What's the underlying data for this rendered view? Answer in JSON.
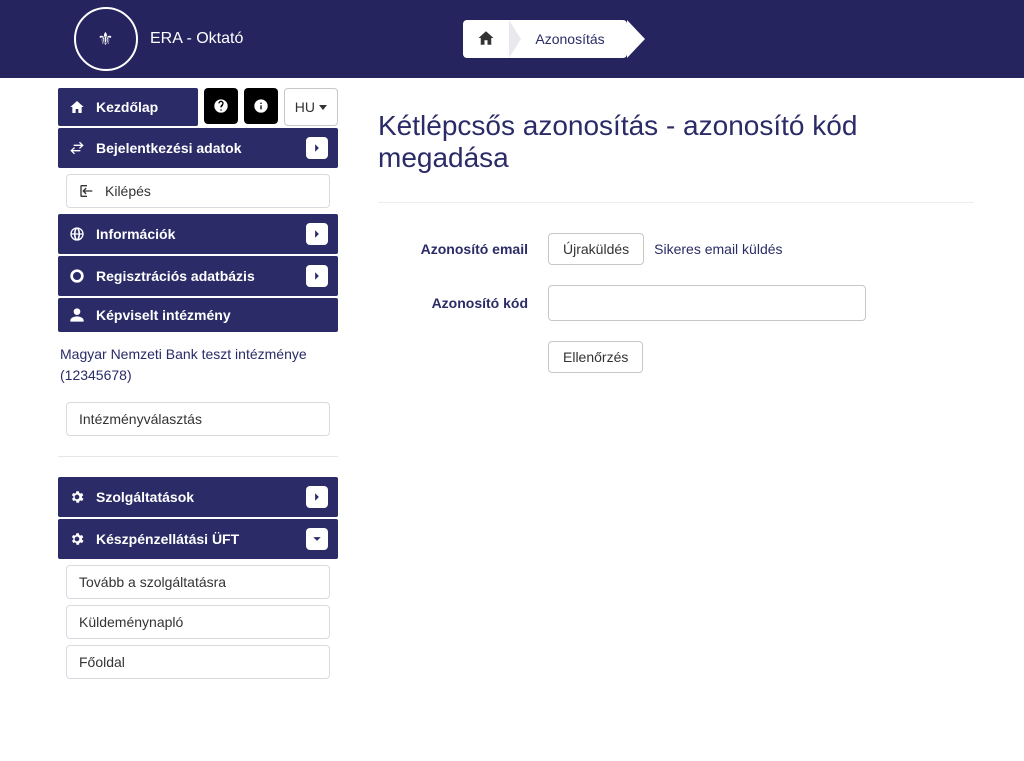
{
  "header": {
    "brand": "ERA - Oktató",
    "breadcrumb": "Azonosítás"
  },
  "sidebar": {
    "home": "Kezdőlap",
    "lang": "HU",
    "login_data": "Bejelentkezési adatok",
    "logout": "Kilépés",
    "info": "Információk",
    "regdb": "Regisztrációs adatbázis",
    "represented": "Képviselt intézmény",
    "institution_text": "Magyar Nemzeti Bank teszt intézménye (12345678)",
    "choose_institution": "Intézményválasztás",
    "services": "Szolgáltatások",
    "cash_service": "Készpénzellátási ÜFT",
    "cash_sub": {
      "forward": "Tovább a szolgáltatásra",
      "log": "Küldeménynapló",
      "main": "Főoldal"
    }
  },
  "main": {
    "title": "Kétlépcsős azonosítás - azonosító kód megadása",
    "email_label": "Azonosító email",
    "resend": "Újraküldés",
    "email_status": "Sikeres email küldés",
    "code_label": "Azonosító kód",
    "code_value": "",
    "verify": "Ellenőrzés"
  }
}
